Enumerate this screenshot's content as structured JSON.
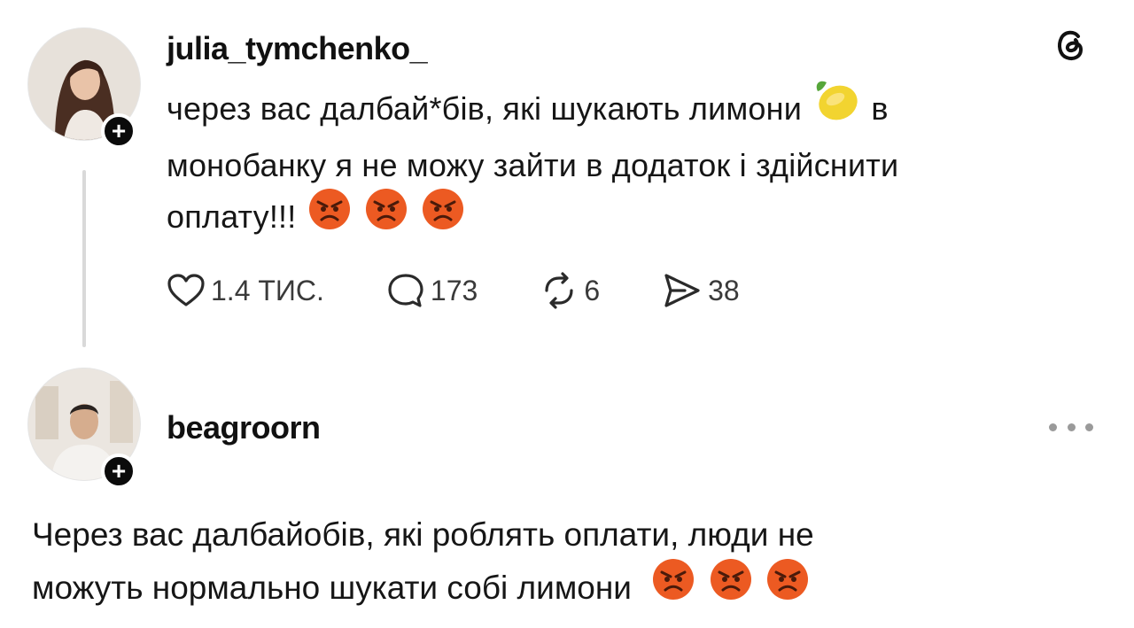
{
  "post": {
    "username": "julia_tymchenko_",
    "text_line1": "через вас далбай*бів, які шукають лимони",
    "text_line1_end": "в",
    "text_line2": "монобанку я не можу зайти в додаток і здійснити",
    "text_line3": "оплату!!!",
    "likes": "1.4 ТИС.",
    "replies": "173",
    "reposts": "6",
    "shares": "38",
    "icons": {
      "lemon": "lemon-emoji",
      "angry": "angry-face-emoji",
      "like": "heart-icon",
      "reply": "speech-bubble-icon",
      "repost": "repost-icon",
      "share": "send-icon",
      "brand": "threads-logo-icon"
    }
  },
  "reply": {
    "username": "beagroorn",
    "text_line1": "Через вас далбайобів, які роблять оплати, люди не",
    "text_line2": "можуть нормально шукати собі лимони"
  },
  "colors": {
    "badge": "#0b0b0b",
    "thread_line": "#d9d9d9",
    "angry_face": "#e8491d"
  }
}
